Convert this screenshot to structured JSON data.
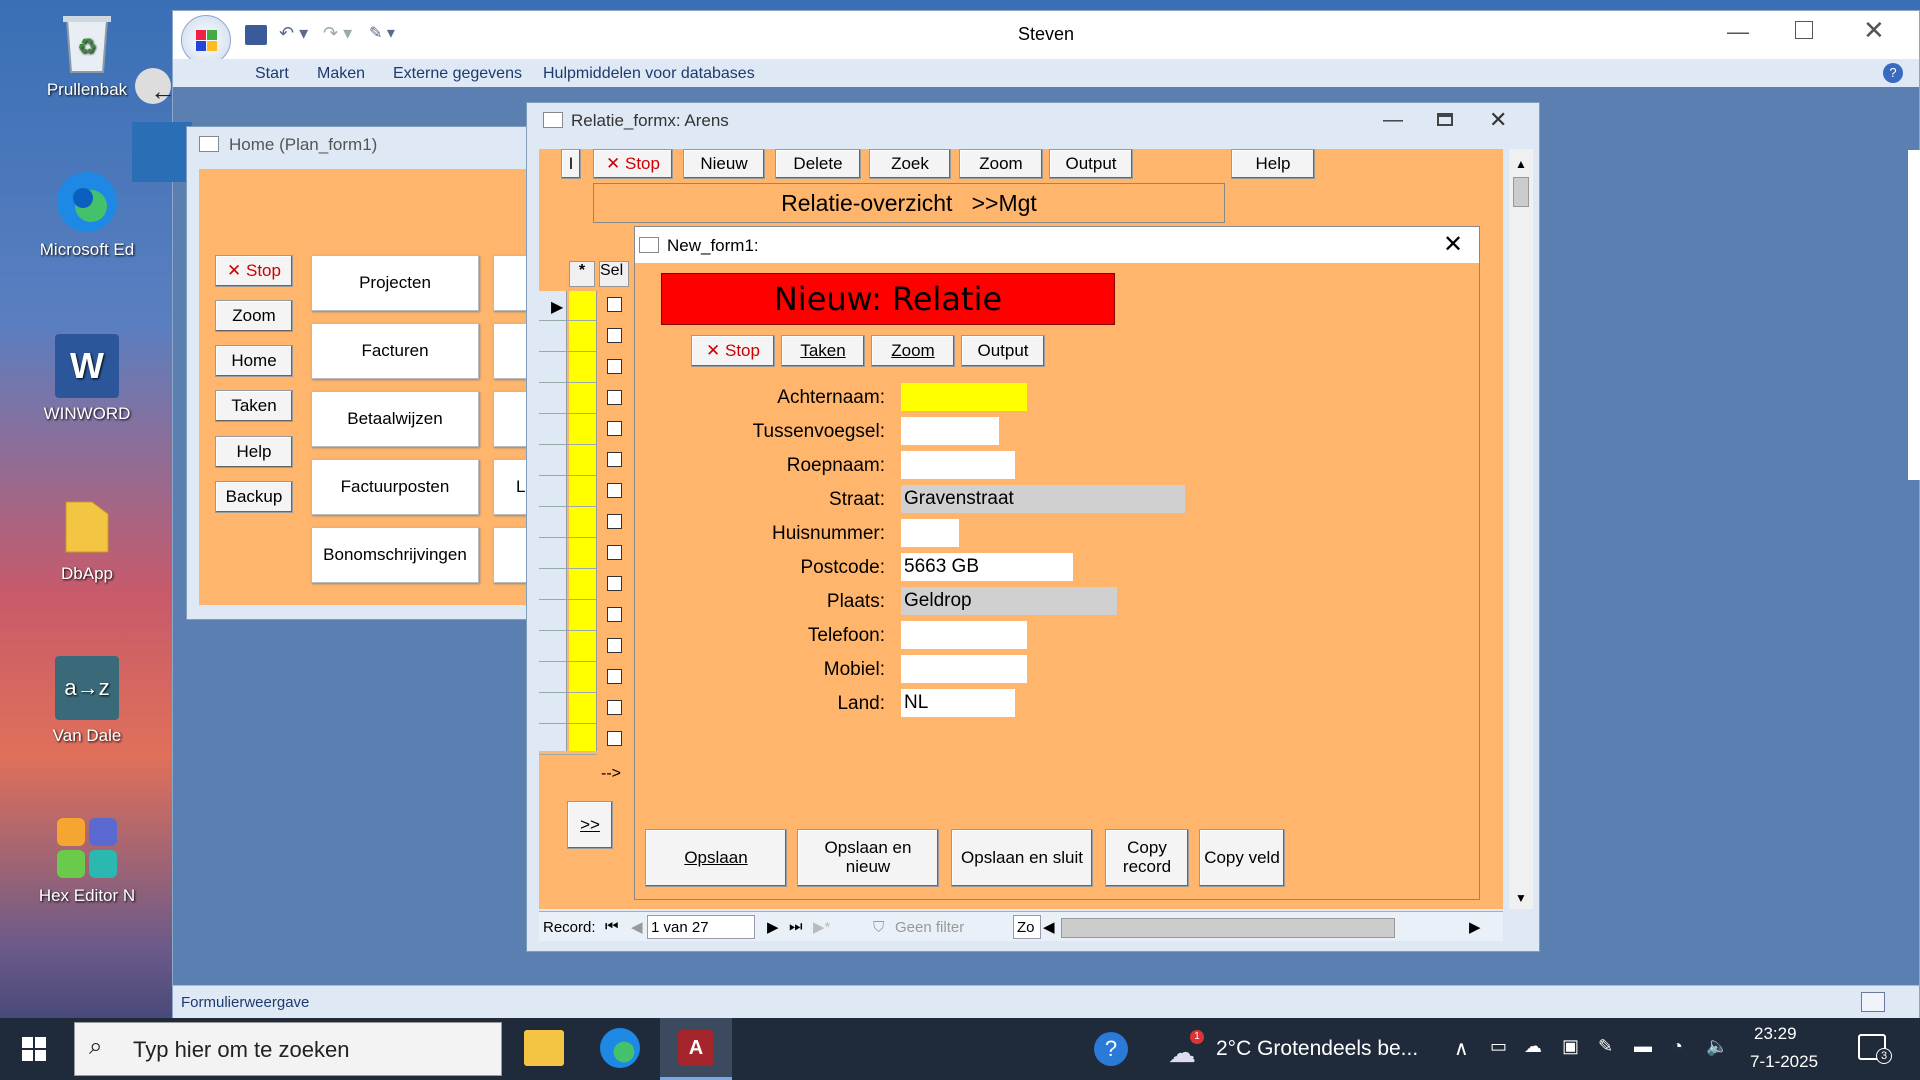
{
  "desktop": {
    "icons": [
      {
        "label": "Prullenbak",
        "icon": "recycle-bin"
      },
      {
        "label": "Microsoft Ed",
        "icon": "edge"
      },
      {
        "label": "WINWORD",
        "icon": "word"
      },
      {
        "label": "DbApp",
        "icon": "folder"
      },
      {
        "label": "Van Dale",
        "icon": "van-dale"
      },
      {
        "label": "Hex Editor N",
        "icon": "hex-editor"
      }
    ]
  },
  "access": {
    "window_title": "Steven",
    "ribbon_tabs": [
      "Start",
      "Maken",
      "Externe gegevens",
      "Hulpmiddelen voor databases"
    ],
    "status_text": "Formulierweergave"
  },
  "home_form": {
    "title": "Home (Plan_form1)",
    "side_buttons": [
      "✕ Stop",
      "Zoom",
      "Home",
      "Taken",
      "Help",
      "Backup"
    ],
    "main_buttons": [
      "Projecten",
      "Facturen",
      "Betaalwijzen",
      "Factuurposten",
      "Bonomschrijvingen"
    ],
    "partial_letter": "L"
  },
  "relatie_form": {
    "title": "Relatie_formx: Arens",
    "toolbar": [
      "I",
      "✕ Stop",
      "Nieuw",
      "Delete",
      "Zoek",
      "Zoom",
      "Output",
      "Help"
    ],
    "header": "Relatie-overzicht   >>Mgt",
    "col_star": "*",
    "col_sel": "Sel",
    "arrow_text": "-->",
    "more_button": ">>",
    "nav": {
      "record_label": "Record:",
      "record_value": "1 van 27",
      "filter": "Geen filter",
      "search": "Zo"
    }
  },
  "new_form": {
    "title": "New_form1:",
    "banner": "Nieuw: Relatie",
    "toolbar": [
      "✕ Stop",
      "Taken",
      "Zoom",
      "Output"
    ],
    "fields": [
      {
        "label": "Achternaam:",
        "value": ""
      },
      {
        "label": "Tussenvoegsel:",
        "value": ""
      },
      {
        "label": "Roepnaam:",
        "value": ""
      },
      {
        "label": "Straat:",
        "value": "Gravenstraat"
      },
      {
        "label": "Huisnummer:",
        "value": ""
      },
      {
        "label": "Postcode:",
        "value": "5663 GB"
      },
      {
        "label": "Plaats:",
        "value": "Geldrop"
      },
      {
        "label": "Telefoon:",
        "value": ""
      },
      {
        "label": "Mobiel:",
        "value": ""
      },
      {
        "label": "Land:",
        "value": "NL"
      }
    ],
    "bottom_buttons": [
      "Opslaan",
      "Opslaan en nieuw",
      "Opslaan en sluit",
      "Copy record",
      "Copy veld"
    ]
  },
  "taskbar": {
    "search_placeholder": "Typ hier om te zoeken",
    "weather": "2°C  Grotendeels be...",
    "time": "23:29",
    "date": "7-1-2025",
    "notification_count": "3",
    "weather_badge": "1"
  }
}
